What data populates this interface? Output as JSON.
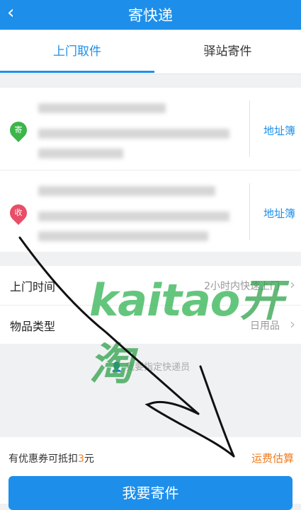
{
  "header": {
    "back": "‹",
    "title": "寄快递"
  },
  "tabs": [
    {
      "label": "上门取件",
      "active": true
    },
    {
      "label": "驿站寄件",
      "active": false
    }
  ],
  "sender": {
    "badge": "寄",
    "book_label": "地址簿"
  },
  "receiver": {
    "badge": "收",
    "book_label": "地址簿"
  },
  "pickup_time": {
    "label": "上门时间",
    "value": "2小时内快速上门"
  },
  "item_type": {
    "label": "物品类型",
    "value": "日用品"
  },
  "courier_link": "我要指定快递员",
  "coupon": {
    "prefix": "有优惠券可抵扣",
    "amount": "3",
    "suffix": "元"
  },
  "estimate_label": "运费估算",
  "submit_label": "我要寄件",
  "watermark": {
    "latin": "kaitao",
    "cn": "开淘"
  },
  "colors": {
    "primary": "#1d8fea",
    "accent": "#f07b1d",
    "sender_pin": "#3cb54a",
    "receiver_pin": "#e94e67"
  }
}
